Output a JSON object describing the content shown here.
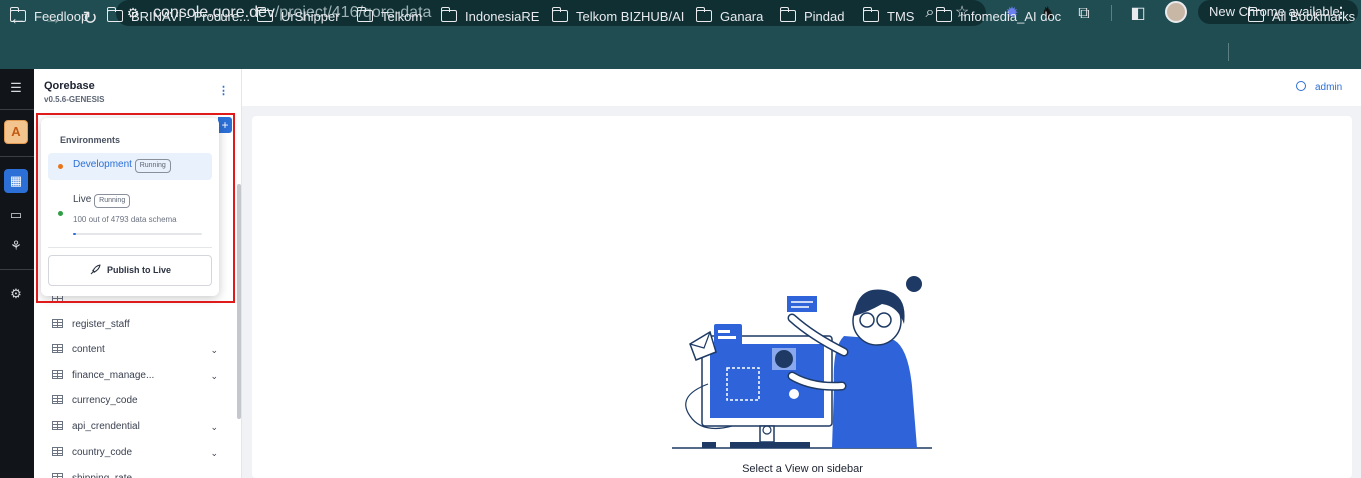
{
  "browser": {
    "url_main": "console.qore.dev",
    "url_path": "/project/416/qore-data",
    "new_chrome_label": "New Chrome available"
  },
  "bookmarks": [
    {
      "label": "Feedloop"
    },
    {
      "label": "BRINAVI - Procure..."
    },
    {
      "label": "UrShipper"
    },
    {
      "label": "Telkom"
    },
    {
      "label": "IndonesiaRE"
    },
    {
      "label": "Telkom BIZHUB/AI"
    },
    {
      "label": "Ganara"
    },
    {
      "label": "Pindad"
    },
    {
      "label": "TMS"
    },
    {
      "label": "Infomedia_AI doc"
    }
  ],
  "all_bookmarks_label": "All Bookmarks",
  "rail": {
    "project_letter": "A"
  },
  "sidebar": {
    "project_name": "Qorebase",
    "project_version": "v0.5.6-GENESIS",
    "tables": [
      {
        "label": "register_staff",
        "expandable": false
      },
      {
        "label": "content",
        "expandable": true
      },
      {
        "label": "finance_manage...",
        "expandable": true
      },
      {
        "label": "currency_code",
        "expandable": false
      },
      {
        "label": "api_crendential",
        "expandable": true
      },
      {
        "label": "country_code",
        "expandable": true
      },
      {
        "label": "shipping_rate",
        "expandable": false
      }
    ]
  },
  "environments": {
    "title": "Environments",
    "development": {
      "label": "Development",
      "status": "Running",
      "dot_color": "#e8751a"
    },
    "live": {
      "label": "Live",
      "status": "Running",
      "dot_color": "#2f9e44",
      "summary": "100 out of 4793 data schema",
      "progress_fraction": 0.021
    },
    "publish_label": "Publish to Live"
  },
  "header": {
    "user_label": "admin"
  },
  "main": {
    "empty_state_text": "Select a View on sidebar"
  },
  "colors": {
    "accent": "#2c6fd6",
    "chrome_frame": "#1f4d52",
    "highlight": "#e0191b"
  }
}
